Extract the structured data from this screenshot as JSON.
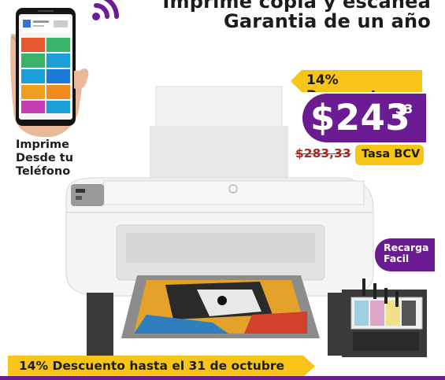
{
  "headline": {
    "line1": "Imprime copia y escanea",
    "line2": "Garantia de un año"
  },
  "phone": {
    "caption_line1": "Imprime",
    "caption_line2": "Desde tu",
    "caption_line3": "Teléfono",
    "icon": "smartphone-icon"
  },
  "wifi_icon": "wifi-icon",
  "discount_tag": "14% Descuento",
  "price": {
    "symbol_amount": "$243",
    "cents": "33"
  },
  "old_price": "$283,33",
  "rate_badge": "Tasa BCV",
  "recarga": {
    "line1": "Recarga",
    "line2": "Facil"
  },
  "bottom_banner": "14% Descuento hasta el 31 de octubre",
  "colors": {
    "accent_purple": "#6b1c93",
    "accent_yellow": "#f6c518",
    "strike_red": "#b3261e",
    "text_dark": "#1c1c1c"
  }
}
